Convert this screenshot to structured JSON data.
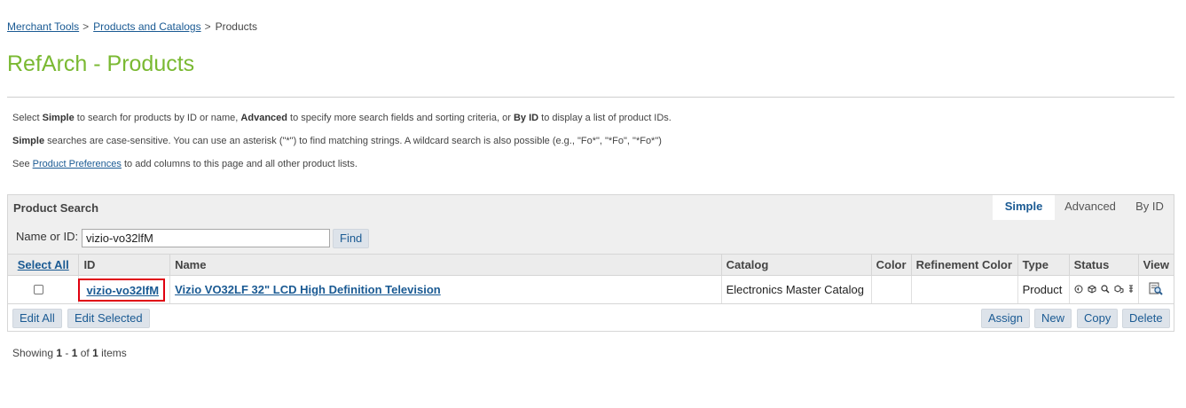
{
  "breadcrumb": {
    "items": [
      "Merchant Tools",
      "Products and Catalogs"
    ],
    "separator": ">",
    "current": "Products"
  },
  "page_title": "RefArch - Products",
  "help": {
    "line1": {
      "p1": "Select ",
      "b1": "Simple",
      "p2": " to search for products by ID or name, ",
      "b2": "Advanced",
      "p3": " to specify more search fields and sorting criteria, or ",
      "b3": "By ID",
      "p4": " to display a list of product IDs."
    },
    "line2": {
      "b1": "Simple",
      "p1": " searches are case-sensitive. You can use an asterisk (\"*\") to find matching strings. A wildcard search is also possible (e.g., \"Fo*\", \"*Fo\", \"*Fo*\")"
    },
    "line3": {
      "p1": "See ",
      "link": "Product Preferences",
      "p2": " to add columns to this page and all other product lists."
    }
  },
  "search": {
    "title": "Product Search",
    "tabs": [
      "Simple",
      "Advanced",
      "By ID"
    ],
    "active_tab": "Simple",
    "name_label": "Name or ID:",
    "value": "vizio-vo32lfM",
    "find_label": "Find"
  },
  "table": {
    "headers": {
      "select_all": "Select All",
      "id": "ID",
      "name": "Name",
      "catalog": "Catalog",
      "color": "Color",
      "refinement_color": "Refinement Color",
      "type": "Type",
      "status": "Status",
      "view": "View"
    },
    "rows": [
      {
        "id": "vizio-vo32lfM",
        "name": "Vizio VO32LF 32\" LCD High Definition Television",
        "catalog": "Electronics Master Catalog",
        "color": "",
        "refinement_color": "",
        "type": "Product",
        "status_icons": [
          "online-status-icon",
          "product-set-icon",
          "searchable-icon",
          "bundle-icon",
          "variation-icon"
        ],
        "view_icon": "view-icon"
      }
    ]
  },
  "footer": {
    "edit_all": "Edit All",
    "edit_selected": "Edit Selected",
    "assign": "Assign",
    "new": "New",
    "copy": "Copy",
    "delete": "Delete"
  },
  "showing": {
    "p1": "Showing ",
    "from": "1",
    "p2": " - ",
    "to": "1",
    "p3": " of ",
    "total": "1",
    "p4": " items"
  },
  "colors": {
    "title_green": "#7ab932",
    "link_blue": "#1a5a93",
    "highlight_red": "#e0000f"
  }
}
